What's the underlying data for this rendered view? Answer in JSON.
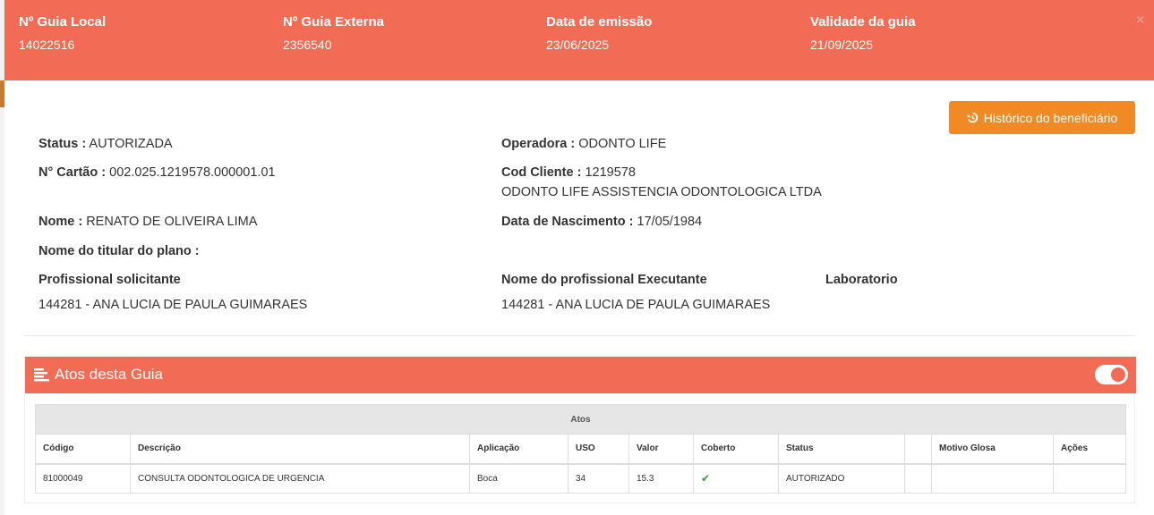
{
  "header": {
    "guia_local_label": "Nº Guia Local",
    "guia_local_value": "14022516",
    "guia_externa_label": "Nº Guia Externa",
    "guia_externa_value": "2356540",
    "emissao_label": "Data de emissão",
    "emissao_value": "23/06/2025",
    "validade_label": "Validade da guia",
    "validade_value": "21/09/2025",
    "close": "×"
  },
  "historico_button": "Histórico do beneficiário",
  "info": {
    "status_label": "Status :",
    "status_value": "AUTORIZADA",
    "operadora_label": "Operadora :",
    "operadora_value": "ODONTO LIFE",
    "cartao_label": "N° Cartão :",
    "cartao_value": "002.025.1219578.000001.01",
    "cod_cliente_label": "Cod Cliente :",
    "cod_cliente_value": "1219578",
    "cliente_nome": "ODONTO LIFE ASSISTENCIA ODONTOLOGICA LTDA",
    "nome_label": "Nome :",
    "nome_value": "RENATO DE OLIVEIRA LIMA",
    "nascimento_label": "Data de Nascimento :",
    "nascimento_value": "17/05/1984",
    "titular_label": "Nome do titular do plano :",
    "titular_value": "",
    "solicitante_label": "Profissional solicitante",
    "solicitante_value": "144281 - ANA LUCIA DE PAULA GUIMARAES",
    "executante_label": "Nome do profissional Executante",
    "executante_value": "144281 - ANA LUCIA DE PAULA GUIMARAES",
    "laboratorio_label": "Laboratorio",
    "laboratorio_value": ""
  },
  "panel": {
    "title": "Atos desta Guia",
    "toggle_on": true
  },
  "table": {
    "caption": "Atos",
    "columns": [
      "Código",
      "Descrição",
      "Aplicação",
      "USO",
      "Valor",
      "Coberto",
      "Status",
      "",
      "Motivo Glosa",
      "Ações"
    ],
    "rows": [
      {
        "codigo": "81000049",
        "descricao": "CONSULTA ODONTOLOGICA DE URGENCIA",
        "aplicacao": "Boca",
        "uso": "34",
        "valor": "15.3",
        "coberto": "✔",
        "status": "AUTORIZADO",
        "extra": "",
        "motivo_glosa": "",
        "acoes": ""
      }
    ]
  },
  "colors": {
    "header_bg": "#f26b55",
    "button_bg": "#f08a24",
    "check": "#2a9d3b"
  }
}
